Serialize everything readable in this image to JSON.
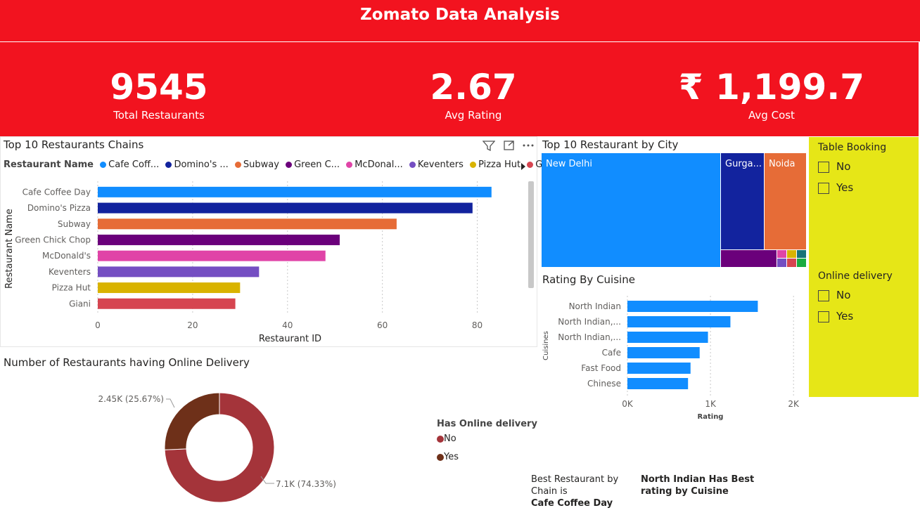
{
  "header": {
    "title": "Zomato Data Analysis"
  },
  "kpis": [
    {
      "value": "9545",
      "label": "Total Restaurants"
    },
    {
      "value": "2.67",
      "label": "Avg Rating"
    },
    {
      "value": "₹ 1,199.7",
      "label": "Avg Cost"
    }
  ],
  "chains": {
    "title": "Top 10 Restaurants Chains",
    "legend_title": "Restaurant Name",
    "legend": [
      {
        "label": "Cafe Coff...",
        "color": "#118dff"
      },
      {
        "label": "Domino's ...",
        "color": "#12239e"
      },
      {
        "label": "Subway",
        "color": "#e66c37"
      },
      {
        "label": "Green C...",
        "color": "#6b007b"
      },
      {
        "label": "McDonal...",
        "color": "#e044a7"
      },
      {
        "label": "Keventers",
        "color": "#744ec2"
      },
      {
        "label": "Pizza Hut",
        "color": "#d9b300"
      },
      {
        "label": "Giani",
        "color": "#d64550"
      }
    ],
    "icons": [
      "filter-icon",
      "focus-mode-icon",
      "more-options-icon",
      "legend-next-icon"
    ]
  },
  "online_delivery": {
    "title": "Number of Restaurants having Online Delivery",
    "legend_title": "Has Online delivery",
    "legend": [
      {
        "label": "No",
        "color": "#a4343a"
      },
      {
        "label": "Yes",
        "color": "#6e3019"
      }
    ]
  },
  "city": {
    "title": "Top 10 Restaurant by City"
  },
  "cuisine": {
    "title": "Rating By Cuisine"
  },
  "slicers": {
    "table_booking": {
      "title": "Table Booking",
      "options": [
        "No",
        "Yes"
      ]
    },
    "online_delivery": {
      "title": "Online delivery",
      "options": [
        "No",
        "Yes"
      ]
    }
  },
  "notes": {
    "best_chain_line1": "Best Restaurant by",
    "best_chain_line2": "Chain is",
    "best_chain_value": "Cafe Coffee Day",
    "best_cuisine_line1": "North Indian Has Best",
    "best_cuisine_line2": "rating by Cuisine"
  },
  "chart_data": [
    {
      "type": "bar",
      "orientation": "horizontal",
      "categories": [
        "Cafe Coffee Day",
        "Domino's Pizza",
        "Subway",
        "Green Chick Chop",
        "McDonald's",
        "Keventers",
        "Pizza Hut",
        "Giani"
      ],
      "values": [
        83,
        79,
        63,
        51,
        48,
        34,
        30,
        29
      ],
      "colors": [
        "#118dff",
        "#12239e",
        "#e66c37",
        "#6b007b",
        "#e044a7",
        "#744ec2",
        "#d9b300",
        "#d64550"
      ],
      "xlabel": "Restaurant ID",
      "ylabel": "Restaurant Name",
      "xlim": [
        0,
        90
      ],
      "xticks": [
        0,
        20,
        40,
        60,
        80
      ],
      "grid": true
    },
    {
      "type": "pie",
      "donut": true,
      "labels": [
        "No",
        "Yes"
      ],
      "values": [
        7100,
        2450
      ],
      "percents": [
        74.33,
        25.67
      ],
      "data_labels": [
        "7.1K (74.33%)",
        "2.45K (25.67%)"
      ],
      "colors": [
        "#a4343a",
        "#6e3019"
      ]
    },
    {
      "type": "treemap",
      "labels": [
        "New Delhi",
        "Gurga...",
        "Noida",
        "",
        "",
        "",
        "",
        "",
        "",
        ""
      ],
      "colors": [
        "#118dff",
        "#12239e",
        "#e66c37",
        "#6b007b",
        "#e044a7",
        "#744ec2",
        "#d9b300",
        "#d64550",
        "#197278",
        "#1aab40"
      ]
    },
    {
      "type": "bar",
      "orientation": "horizontal",
      "categories": [
        "North Indian",
        "North Indian,...",
        "North Indian,...",
        "Cafe",
        "Fast Food",
        "Chinese"
      ],
      "values": [
        1570,
        1240,
        970,
        870,
        760,
        730
      ],
      "color": "#118dff",
      "xlabel": "Rating",
      "ylabel": "Cuisines",
      "xlim": [
        0,
        2100
      ],
      "xtick_labels": [
        "0K",
        "1K",
        "2K"
      ],
      "xticks": [
        0,
        1000,
        2000
      ],
      "grid": true
    }
  ]
}
